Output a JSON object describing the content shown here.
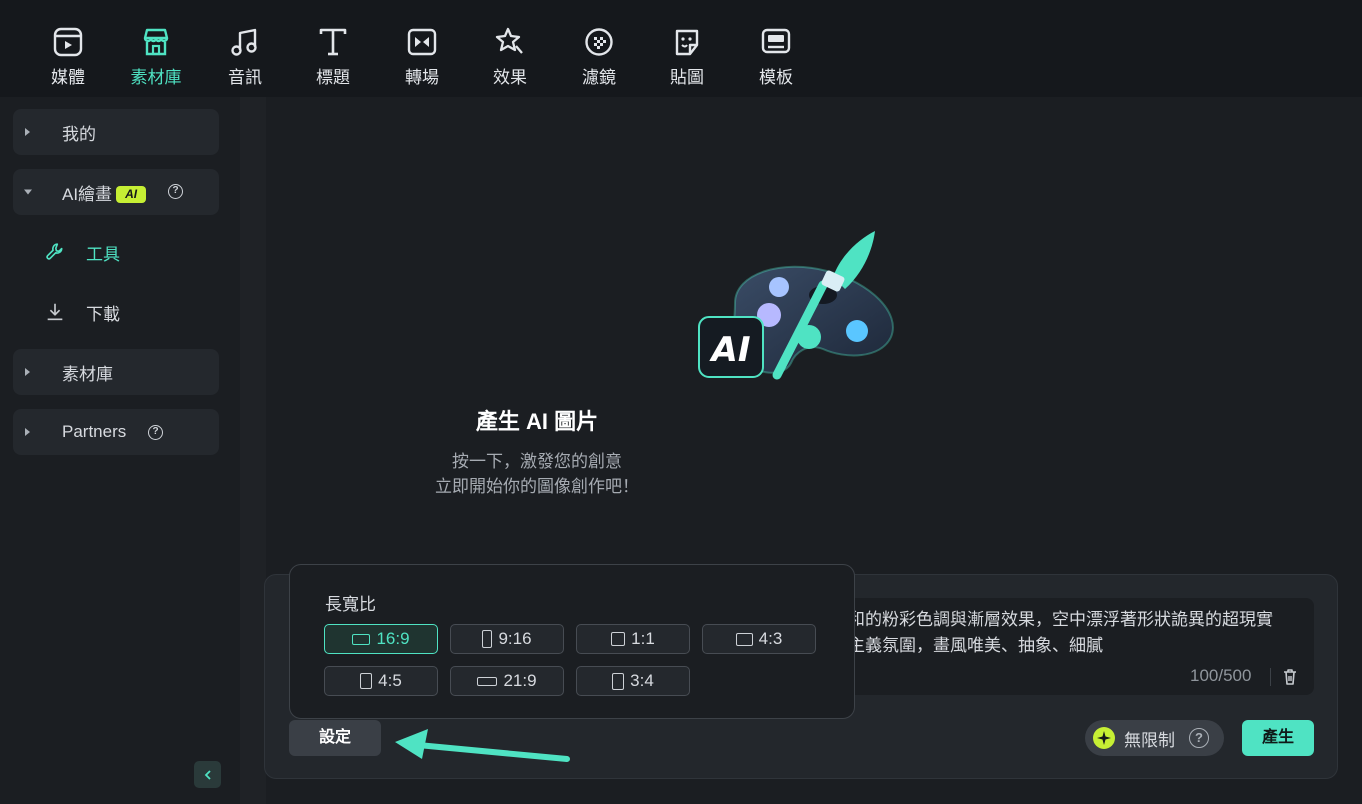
{
  "toolbar": {
    "items": [
      {
        "label": "媒體",
        "icon": "media-icon"
      },
      {
        "label": "素材庫",
        "icon": "stock-store-icon",
        "active": true
      },
      {
        "label": "音訊",
        "icon": "music-note-icon"
      },
      {
        "label": "標題",
        "icon": "text-t-icon"
      },
      {
        "label": "轉場",
        "icon": "transition-icon"
      },
      {
        "label": "效果",
        "icon": "effects-star-icon"
      },
      {
        "label": "濾鏡",
        "icon": "filter-icon"
      },
      {
        "label": "貼圖",
        "icon": "sticker-icon"
      },
      {
        "label": "模板",
        "icon": "template-icon"
      }
    ]
  },
  "sidebar": {
    "my": "我的",
    "ai_painting": "AI繪畫",
    "ai_badge": "AI",
    "tools": "工具",
    "download": "下載",
    "stock": "素材庫",
    "partners": "Partners"
  },
  "hero": {
    "title": "產生 AI 圖片",
    "line1": "按一下，激發您的創意",
    "line2": "立即開始你的圖像創作吧！"
  },
  "prompt": {
    "text": "和的粉彩色調與漸層效果，空中漂浮著形狀詭異的超現實\n主義氛圍，畫風唯美、抽象、細膩",
    "counter": "100/500"
  },
  "aspect_ratio": {
    "title": "長寬比",
    "options": [
      "16:9",
      "9:16",
      "1:1",
      "4:3",
      "4:5",
      "21:9",
      "3:4"
    ],
    "selected": "16:9"
  },
  "buttons": {
    "settings": "設定",
    "unlimited": "無限制",
    "generate": "產生"
  },
  "colors": {
    "accent": "#4fe3c3",
    "badge": "#c6ef34",
    "background": "#1b1e22"
  }
}
